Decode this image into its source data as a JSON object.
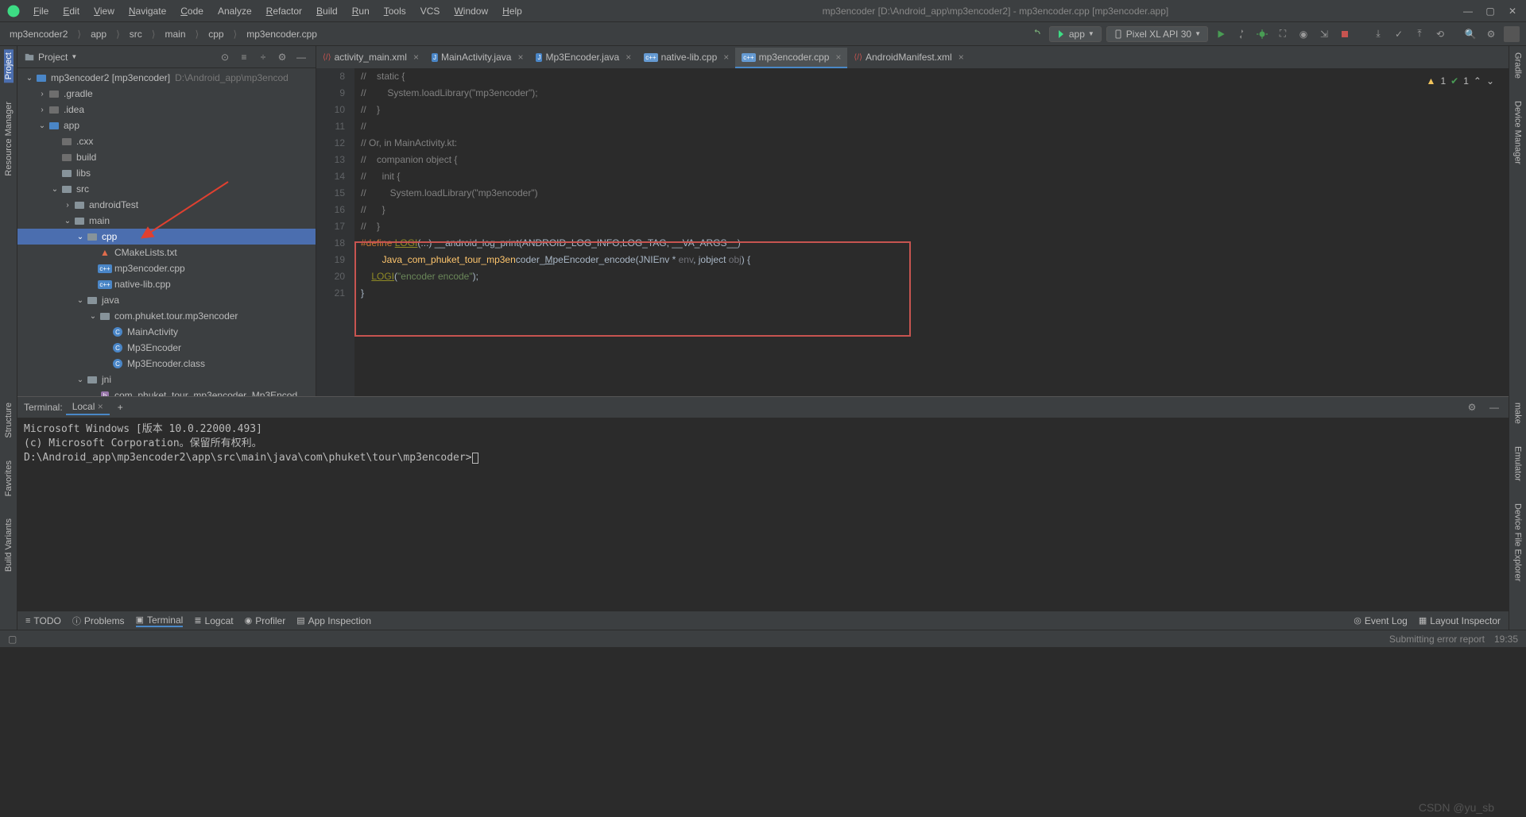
{
  "window": {
    "title": "mp3encoder [D:\\Android_app\\mp3encoder2] - mp3encoder.cpp [mp3encoder.app]"
  },
  "menu": [
    "File",
    "Edit",
    "View",
    "Navigate",
    "Code",
    "Analyze",
    "Refactor",
    "Build",
    "Run",
    "Tools",
    "VCS",
    "Window",
    "Help"
  ],
  "breadcrumbs": [
    "mp3encoder2",
    "app",
    "src",
    "main",
    "cpp",
    "mp3encoder.cpp"
  ],
  "toolbar": {
    "config": "app",
    "device": "Pixel XL API 30"
  },
  "project_panel": {
    "title": "Project"
  },
  "tree": [
    {
      "depth": 0,
      "exp": "v",
      "icon": "mod",
      "label": "mp3encoder2 [mp3encoder]",
      "suffix": "D:\\Android_app\\mp3encod"
    },
    {
      "depth": 1,
      "exp": ">",
      "icon": "dim",
      "label": ".gradle"
    },
    {
      "depth": 1,
      "exp": ">",
      "icon": "dim",
      "label": ".idea"
    },
    {
      "depth": 1,
      "exp": "v",
      "icon": "mod",
      "label": "app"
    },
    {
      "depth": 2,
      "exp": "",
      "icon": "dim",
      "label": ".cxx"
    },
    {
      "depth": 2,
      "exp": "",
      "icon": "dim",
      "label": "build"
    },
    {
      "depth": 2,
      "exp": "",
      "icon": "folder",
      "label": "libs"
    },
    {
      "depth": 2,
      "exp": "v",
      "icon": "folder",
      "label": "src"
    },
    {
      "depth": 3,
      "exp": ">",
      "icon": "folder",
      "label": "androidTest"
    },
    {
      "depth": 3,
      "exp": "v",
      "icon": "folder",
      "label": "main"
    },
    {
      "depth": 4,
      "exp": "v",
      "icon": "folder",
      "label": "cpp",
      "sel": true
    },
    {
      "depth": 5,
      "exp": "",
      "icon": "cmake",
      "label": "CMakeLists.txt"
    },
    {
      "depth": 5,
      "exp": "",
      "icon": "cpp",
      "label": "mp3encoder.cpp"
    },
    {
      "depth": 5,
      "exp": "",
      "icon": "cpp",
      "label": "native-lib.cpp"
    },
    {
      "depth": 4,
      "exp": "v",
      "icon": "folder",
      "label": "java"
    },
    {
      "depth": 5,
      "exp": "v",
      "icon": "pkg",
      "label": "com.phuket.tour.mp3encoder"
    },
    {
      "depth": 6,
      "exp": "",
      "icon": "class",
      "label": "MainActivity"
    },
    {
      "depth": 6,
      "exp": "",
      "icon": "class",
      "label": "Mp3Encoder"
    },
    {
      "depth": 6,
      "exp": "",
      "icon": "class",
      "label": "Mp3Encoder.class"
    },
    {
      "depth": 4,
      "exp": "v",
      "icon": "folder",
      "label": "jni"
    },
    {
      "depth": 5,
      "exp": "",
      "icon": "h",
      "label": "com_phuket_tour_mp3encoder_Mp3Encod"
    }
  ],
  "tabs": [
    {
      "icon": "xml",
      "label": "activity_main.xml"
    },
    {
      "icon": "java",
      "label": "MainActivity.java"
    },
    {
      "icon": "java",
      "label": "Mp3Encoder.java"
    },
    {
      "icon": "cpp",
      "label": "native-lib.cpp"
    },
    {
      "icon": "cpp",
      "label": "mp3encoder.cpp",
      "active": true
    },
    {
      "icon": "xml",
      "label": "AndroidManifest.xml"
    }
  ],
  "code": {
    "start": 8,
    "lines": [
      "//    static {",
      "//        System.loadLibrary(\"mp3encoder\");",
      "//    }",
      "//",
      "// Or, in MainActivity.kt:",
      "//    companion object {",
      "//      init {",
      "//         System.loadLibrary(\"mp3encoder\")",
      "//      }",
      "//    }",
      "#define LOGI(...) __android_log_print(ANDROID_LOG_INFO,LOG_TAG, __VA_ARGS__)",
      "        Java_com_phuket_tour_mp3encoder_MpeEncoder_encode(JNIEnv * env, jobject obj) {",
      "    LOGI(\"encoder encode\");",
      "}"
    ]
  },
  "editor_status": {
    "warn": "1",
    "check": "1"
  },
  "terminal": {
    "title": "Terminal:",
    "tab": "Local",
    "lines": [
      "Microsoft Windows [版本 10.0.22000.493]",
      "(c) Microsoft Corporation。保留所有权利。",
      "D:\\Android_app\\mp3encoder2\\app\\src\\main\\java\\com\\phuket\\tour\\mp3encoder>"
    ]
  },
  "bottombar": {
    "items": [
      "TODO",
      "Problems",
      "Terminal",
      "Logcat",
      "Profiler",
      "App Inspection"
    ],
    "right": [
      "Event Log",
      "Layout Inspector"
    ]
  },
  "statusbar": {
    "msg": "Submitting error report",
    "time": "19:35"
  },
  "rails": {
    "left": [
      "Project",
      "Resource Manager"
    ],
    "left2": [
      "Structure",
      "Favorites",
      "Build Variants"
    ],
    "right": [
      "Gradle",
      "Device Manager"
    ],
    "right2": [
      "make",
      "Emulator",
      "Device File Explorer"
    ]
  },
  "watermark": "CSDN @yu_sb"
}
